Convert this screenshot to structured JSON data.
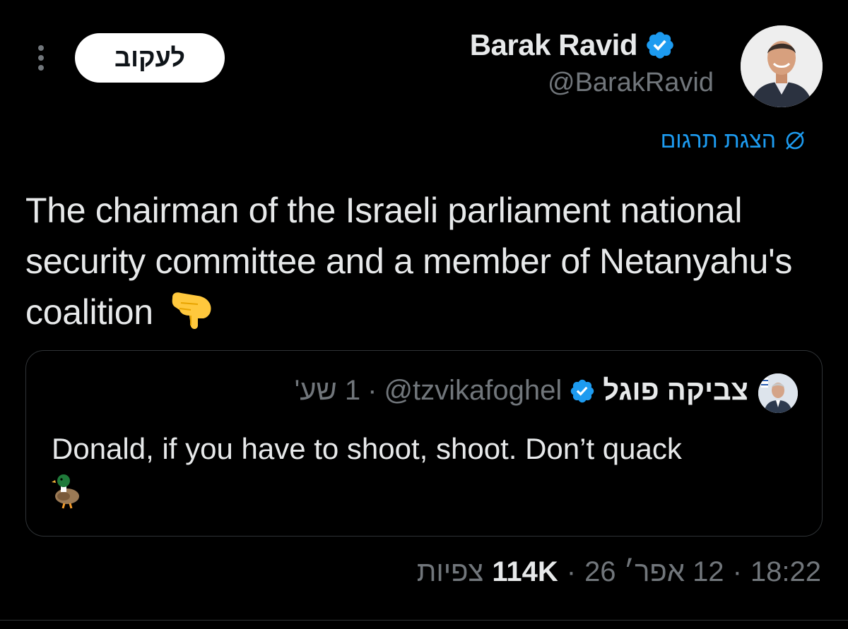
{
  "author": {
    "name": "Barak Ravid",
    "handle": "@BarakRavid",
    "verified": true
  },
  "follow_label": "לעקוב",
  "translate_label": "הצגת תרגום",
  "tweet": {
    "text": "The chairman of the Israeli parliament national security committee and a member of Netanyahu's coalition",
    "emoji": "backhand-index-pointing-down"
  },
  "quote": {
    "name": "צביקה פוגל",
    "handle": "@tzvikafoghel",
    "separator": "·",
    "time": "1 שע'",
    "text": "Donald, if you have to shoot, shoot. Don’t quack",
    "emoji": "duck"
  },
  "meta": {
    "time": "18:22",
    "date": "12 אפר׳ 26",
    "separator": "·",
    "views_count": "114K",
    "views_label": "צפיות"
  },
  "colors": {
    "background": "#000000",
    "text_primary": "#e7e9ea",
    "text_secondary": "#71767b",
    "accent": "#1d9bf0",
    "border": "#2f3336"
  }
}
